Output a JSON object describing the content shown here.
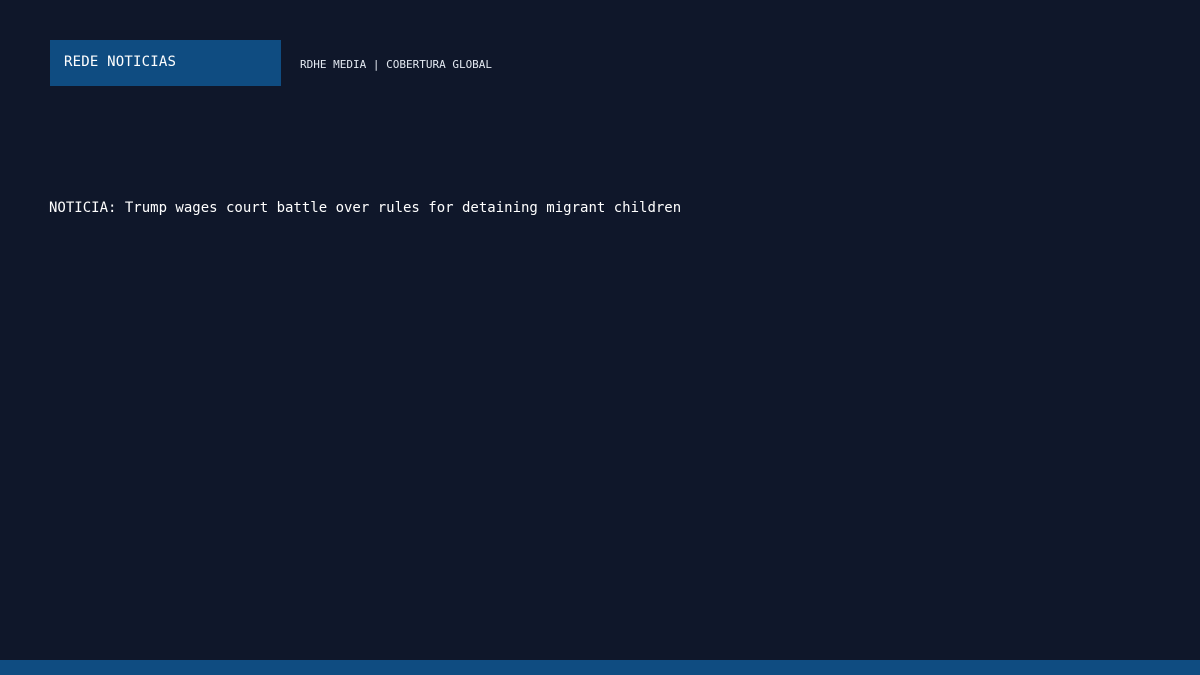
{
  "header": {
    "brand_name": "REDE NOTICIAS",
    "tagline": "RDHE MEDIA | COBERTURA GLOBAL"
  },
  "main": {
    "headline": "NOTICIA: Trump wages court battle over rules for detaining migrant children"
  },
  "colors": {
    "background": "#0f172a",
    "accent": "#0f4c81",
    "text": "#ffffff"
  }
}
